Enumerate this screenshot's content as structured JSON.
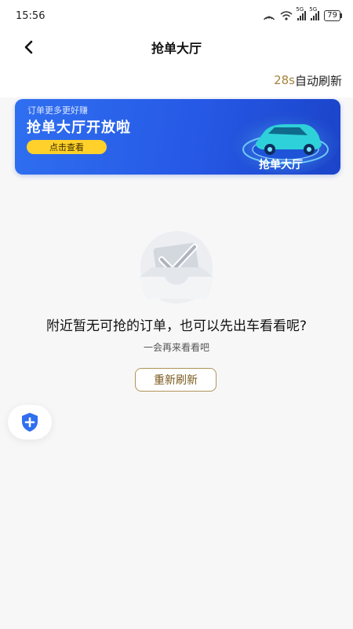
{
  "status_bar": {
    "time": "15:56",
    "signal_tag_1": "5G",
    "signal_tag_2": "5G",
    "battery": "79"
  },
  "nav": {
    "title": "抢单大厅",
    "back_icon": "chevron-left-icon"
  },
  "refresh": {
    "countdown": "28s",
    "label": "自动刷新"
  },
  "banner": {
    "subtitle": "订单更多更好赚",
    "title": "抢单大厅开放啦",
    "button_label": "点击查看",
    "art_text": "抢单大厅"
  },
  "empty_state": {
    "icon": "checkmark-box-icon",
    "message": "附近暂无可抢的订单，也可以先出车看看呢?",
    "sub_message": "一会再来看看吧",
    "reload_label": "重新刷新"
  },
  "floating": {
    "icon": "shield-plus-icon"
  },
  "colors": {
    "accent_gold": "#a5843c",
    "banner_blue": "#2659e6",
    "button_yellow": "#ffd12a"
  }
}
